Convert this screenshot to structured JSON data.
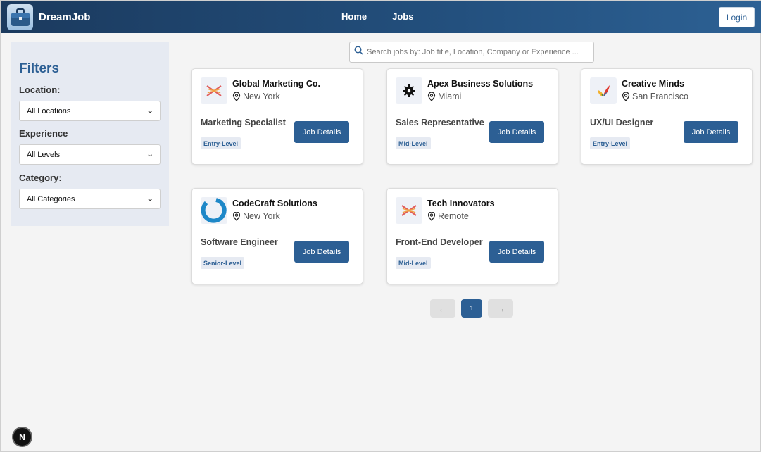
{
  "header": {
    "brand": "DreamJob",
    "nav": [
      "Home",
      "Jobs"
    ],
    "login": "Login"
  },
  "filters": {
    "title": "Filters",
    "location_label": "Location:",
    "location_value": "All Locations",
    "experience_label": "Experience",
    "experience_value": "All Levels",
    "category_label": "Category:",
    "category_value": "All Categories"
  },
  "search": {
    "placeholder": "Search jobs by: Job title, Location, Company or Experience ..."
  },
  "jobs": [
    {
      "company": "Global Marketing Co.",
      "location": "New York",
      "title": "Marketing Specialist",
      "level": "Entry-Level",
      "button": "Job Details",
      "logo": "x-logo-icon"
    },
    {
      "company": "Apex Business Solutions",
      "location": "Miami",
      "title": "Sales Representative",
      "level": "Mid-Level",
      "button": "Job Details",
      "logo": "gear-logo-icon"
    },
    {
      "company": "Creative Minds",
      "location": "San Francisco",
      "title": "UX/UI Designer",
      "level": "Entry-Level",
      "button": "Job Details",
      "logo": "checkmark-logo-icon"
    },
    {
      "company": "CodeCraft Solutions",
      "location": "New York",
      "title": "Software Engineer",
      "level": "Senior-Level",
      "button": "Job Details",
      "logo": "ring-logo-icon"
    },
    {
      "company": "Tech Innovators",
      "location": "Remote",
      "title": "Front-End Developer",
      "level": "Mid-Level",
      "button": "Job Details",
      "logo": "x-logo-icon"
    }
  ],
  "pagination": {
    "prev": "←",
    "page": "1",
    "next": "→"
  },
  "badge": "N",
  "colors": {
    "primary": "#2c5f94",
    "header_start": "#1b3a5e",
    "header_end": "#2d6194",
    "sidebar_bg": "#e6eaf2"
  }
}
